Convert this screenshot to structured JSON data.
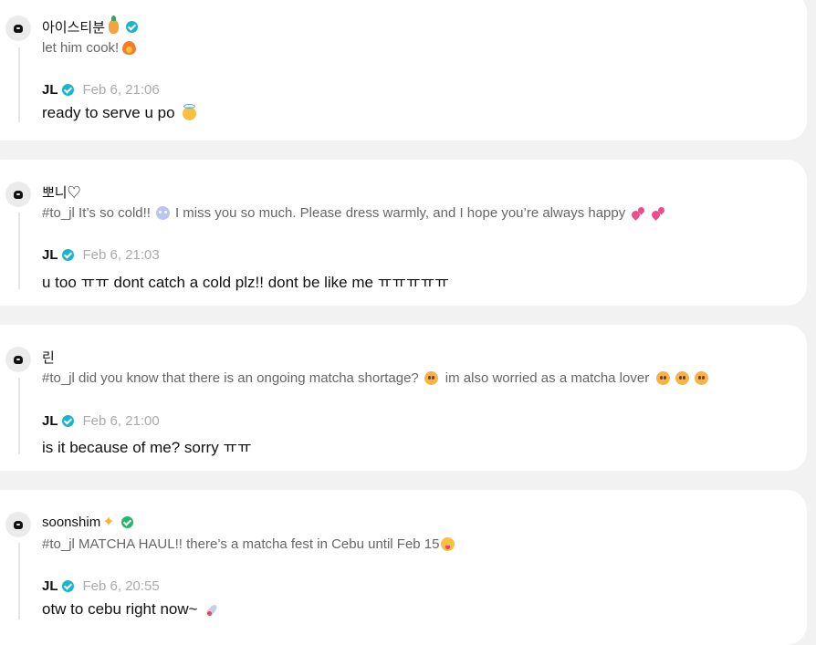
{
  "threads": [
    {
      "fan_name": "아이스티분",
      "fan_message": "let him cook!",
      "reply_author": "JL",
      "reply_time": "Feb 6, 21:06",
      "reply_message": "ready to serve u po"
    },
    {
      "fan_name": "뽀니♡",
      "fan_message_part1": "#to_jl It’s so cold!!",
      "fan_message_part2": "I miss you so much. Please dress warmly, and I hope you’re always happy",
      "reply_author": "JL",
      "reply_time": "Feb 6, 21:03",
      "reply_message": "u too ㅠㅠ dont catch a cold plz!! dont be like me ㅠㅠㅠㅠㅠ"
    },
    {
      "fan_name": "린",
      "fan_message_part1": "#to_jl did you know that there is an ongoing matcha shortage?",
      "fan_message_part2": "im also worried as a matcha lover",
      "reply_author": "JL",
      "reply_time": "Feb 6, 21:00",
      "reply_message": "is it because of me? sorry ㅠㅠ"
    },
    {
      "fan_name": "soonshim",
      "fan_message": "#to_jl MATCHA HAUL!! there’s a matcha fest in Cebu until Feb 15",
      "reply_author": "JL",
      "reply_time": "Feb 6, 20:55",
      "reply_message": "otw to cebu right now~"
    }
  ],
  "colors": {
    "background": "#f2f2f2",
    "card": "#ffffff",
    "verified_badge": "#19b6c9",
    "verified_badge_green": "#1fb86a",
    "timestamp": "#aaaaaa"
  },
  "icons": [
    "avatar-icon",
    "verified-icon",
    "emoji-icon"
  ]
}
